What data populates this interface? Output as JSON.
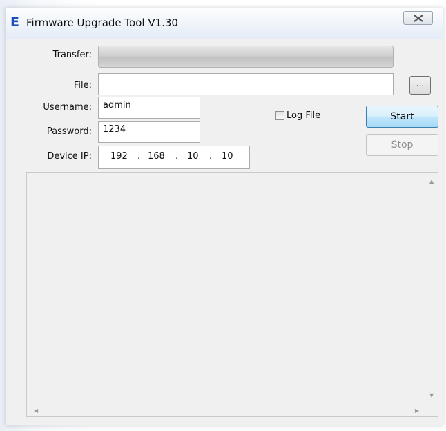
{
  "window": {
    "title": "Firmware Upgrade Tool V1.30",
    "app_icon_glyph": "E",
    "icons": {
      "app": "firmware-app-icon",
      "close": "close-icon"
    }
  },
  "form": {
    "transfer_label": "Transfer:",
    "transfer_progress_fraction": 0,
    "file_label": "File:",
    "file_value": "",
    "browse_label": "...",
    "username_label": "Username:",
    "username_value": "admin",
    "password_label": "Password:",
    "password_value": "1234",
    "device_ip_label": "Device IP:",
    "device_ip": {
      "octet1": "192",
      "octet2": "168",
      "octet3": "10",
      "octet4": "10",
      "separator": "."
    },
    "log_file_label": "Log File",
    "log_file_checked": false
  },
  "buttons": {
    "start": "Start",
    "stop": "Stop",
    "stop_enabled": false
  },
  "log": {
    "text": ""
  },
  "colors": {
    "accent": "#3c7fb1",
    "app_icon": "#1a4fb8",
    "disabled_text": "#8d8d8d"
  }
}
